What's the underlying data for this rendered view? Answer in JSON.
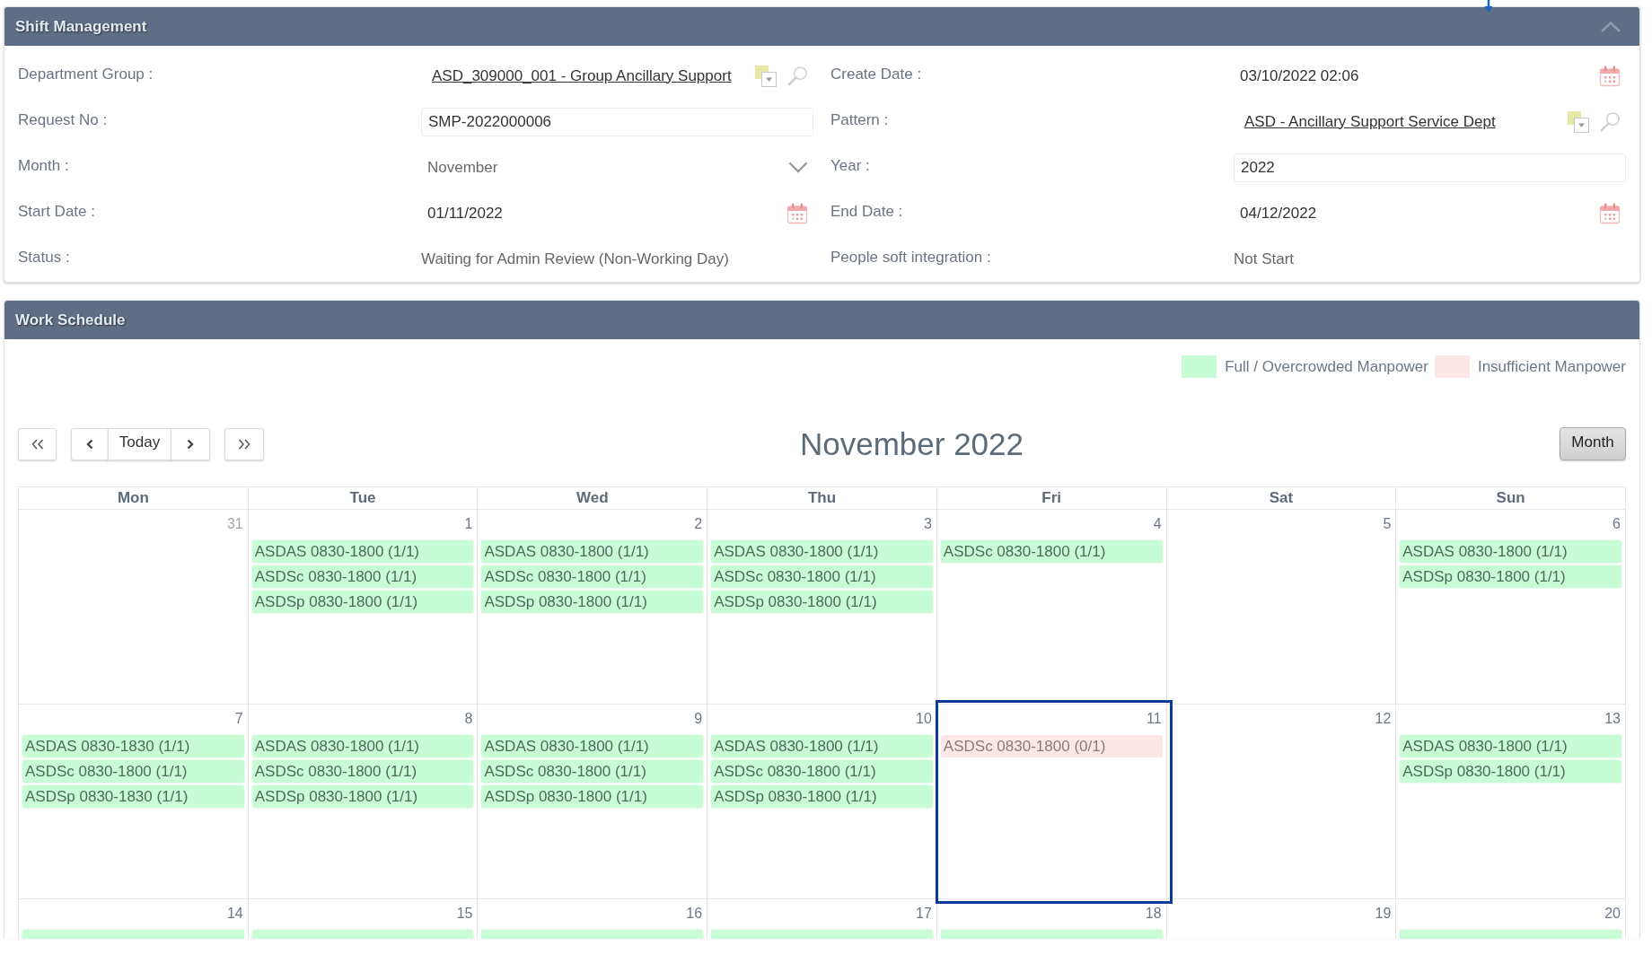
{
  "shift_management": {
    "title": "Shift Management",
    "expanded": true,
    "fields": [
      {
        "label": "Department Group :",
        "kind": "lookup",
        "value": "ASD_309000_001 - Group Ancillary Support"
      },
      {
        "label": "Create Date :",
        "kind": "date",
        "value": "03/10/2022 02:06"
      },
      {
        "label": "Request No :",
        "kind": "text",
        "value": "SMP-2022000006"
      },
      {
        "label": "Pattern :",
        "kind": "lookup",
        "value": "ASD - Ancillary Support Service Dept"
      },
      {
        "label": "Month :",
        "kind": "select",
        "value": "November"
      },
      {
        "label": "Year :",
        "kind": "text",
        "value": "2022"
      },
      {
        "label": "Start Date :",
        "kind": "date",
        "value": "01/11/2022"
      },
      {
        "label": "End Date :",
        "kind": "date",
        "value": "04/12/2022"
      },
      {
        "label": "Status :",
        "kind": "static",
        "value": "Waiting for Admin Review (Non-Working Day)"
      },
      {
        "label": "People soft integration :",
        "kind": "static",
        "value": "Not Start"
      }
    ]
  },
  "work_schedule": {
    "title": "Work Schedule",
    "legend": [
      {
        "kind": "full",
        "label": "Full / Overcrowded Manpower",
        "color": "#c8fcd4"
      },
      {
        "kind": "insufficient",
        "label": "Insufficient Manpower",
        "color": "#fde6e6"
      }
    ],
    "calendar": {
      "nav_buttons": [
        {
          "kind": "prev-year"
        },
        {
          "kind": "prev"
        },
        {
          "kind": "today",
          "label": "Today"
        },
        {
          "kind": "next"
        },
        {
          "kind": "next-year"
        }
      ],
      "title": "November 2022",
      "views": [
        {
          "label": "Month",
          "selected": true
        }
      ],
      "weekdays": [
        "Mon",
        "Tue",
        "Wed",
        "Thu",
        "Fri",
        "Sat",
        "Sun"
      ],
      "weeks": [
        {
          "days": [
            {
              "day": "31",
              "other_month": true,
              "selected": false
            },
            {
              "day": "1",
              "other_month": false,
              "selected": false,
              "events": [
                {
                  "label": "ASDAS 0830-1800 (1/1)",
                  "kind": "full"
                },
                {
                  "label": "ASDSc 0830-1800 (1/1)",
                  "kind": "full"
                },
                {
                  "label": "ASDSp 0830-1800 (1/1)",
                  "kind": "full"
                }
              ]
            },
            {
              "day": "2",
              "other_month": false,
              "selected": false,
              "events": [
                {
                  "label": "ASDAS 0830-1800 (1/1)",
                  "kind": "full"
                },
                {
                  "label": "ASDSc 0830-1800 (1/1)",
                  "kind": "full"
                },
                {
                  "label": "ASDSp 0830-1800 (1/1)",
                  "kind": "full"
                }
              ]
            },
            {
              "day": "3",
              "other_month": false,
              "selected": false,
              "events": [
                {
                  "label": "ASDAS 0830-1800 (1/1)",
                  "kind": "full"
                },
                {
                  "label": "ASDSc 0830-1800 (1/1)",
                  "kind": "full"
                },
                {
                  "label": "ASDSp 0830-1800 (1/1)",
                  "kind": "full"
                }
              ]
            },
            {
              "day": "4",
              "other_month": false,
              "selected": false,
              "events": [
                {
                  "label": "ASDSc 0830-1800 (1/1)",
                  "kind": "full"
                }
              ]
            },
            {
              "day": "5",
              "other_month": false,
              "selected": false
            },
            {
              "day": "6",
              "other_month": false,
              "selected": false,
              "events": [
                {
                  "label": "ASDAS 0830-1800 (1/1)",
                  "kind": "full"
                },
                {
                  "label": "ASDSp 0830-1800 (1/1)",
                  "kind": "full"
                }
              ]
            }
          ]
        },
        {
          "days": [
            {
              "day": "7",
              "other_month": false,
              "selected": false,
              "events": [
                {
                  "label": "ASDAS 0830-1830 (1/1)",
                  "kind": "full"
                },
                {
                  "label": "ASDSc 0830-1800 (1/1)",
                  "kind": "full"
                },
                {
                  "label": "ASDSp 0830-1830 (1/1)",
                  "kind": "full"
                }
              ]
            },
            {
              "day": "8",
              "other_month": false,
              "selected": false,
              "events": [
                {
                  "label": "ASDAS 0830-1800 (1/1)",
                  "kind": "full"
                },
                {
                  "label": "ASDSc 0830-1800 (1/1)",
                  "kind": "full"
                },
                {
                  "label": "ASDSp 0830-1800 (1/1)",
                  "kind": "full"
                }
              ]
            },
            {
              "day": "9",
              "other_month": false,
              "selected": false,
              "events": [
                {
                  "label": "ASDAS 0830-1800 (1/1)",
                  "kind": "full"
                },
                {
                  "label": "ASDSc 0830-1800 (1/1)",
                  "kind": "full"
                },
                {
                  "label": "ASDSp 0830-1800 (1/1)",
                  "kind": "full"
                }
              ]
            },
            {
              "day": "10",
              "other_month": false,
              "selected": false,
              "events": [
                {
                  "label": "ASDAS 0830-1800 (1/1)",
                  "kind": "full"
                },
                {
                  "label": "ASDSc 0830-1800 (1/1)",
                  "kind": "full"
                },
                {
                  "label": "ASDSp 0830-1800 (1/1)",
                  "kind": "full"
                }
              ]
            },
            {
              "day": "11",
              "other_month": false,
              "selected": true,
              "events": [
                {
                  "label": "ASDSc 0830-1800 (0/1)",
                  "kind": "insufficient"
                }
              ]
            },
            {
              "day": "12",
              "other_month": false,
              "selected": false
            },
            {
              "day": "13",
              "other_month": false,
              "selected": false,
              "events": [
                {
                  "label": "ASDAS 0830-1800 (1/1)",
                  "kind": "full"
                },
                {
                  "label": "ASDSp 0830-1800 (1/1)",
                  "kind": "full"
                }
              ]
            }
          ]
        },
        {
          "days": [
            {
              "day": "14",
              "other_month": false,
              "selected": false,
              "events": [
                {
                  "kind": "full"
                }
              ]
            },
            {
              "day": "15",
              "other_month": false,
              "selected": false,
              "events": [
                {
                  "kind": "full"
                }
              ]
            },
            {
              "day": "16",
              "other_month": false,
              "selected": false,
              "events": [
                {
                  "kind": "full"
                }
              ]
            },
            {
              "day": "17",
              "other_month": false,
              "selected": false,
              "events": [
                {
                  "kind": "full"
                }
              ]
            },
            {
              "day": "18",
              "other_month": false,
              "selected": false,
              "events": [
                {
                  "kind": "full"
                }
              ]
            },
            {
              "day": "19",
              "other_month": false,
              "selected": false
            },
            {
              "day": "20",
              "other_month": false,
              "selected": false,
              "events": [
                {
                  "kind": "full"
                }
              ]
            }
          ]
        }
      ]
    }
  }
}
